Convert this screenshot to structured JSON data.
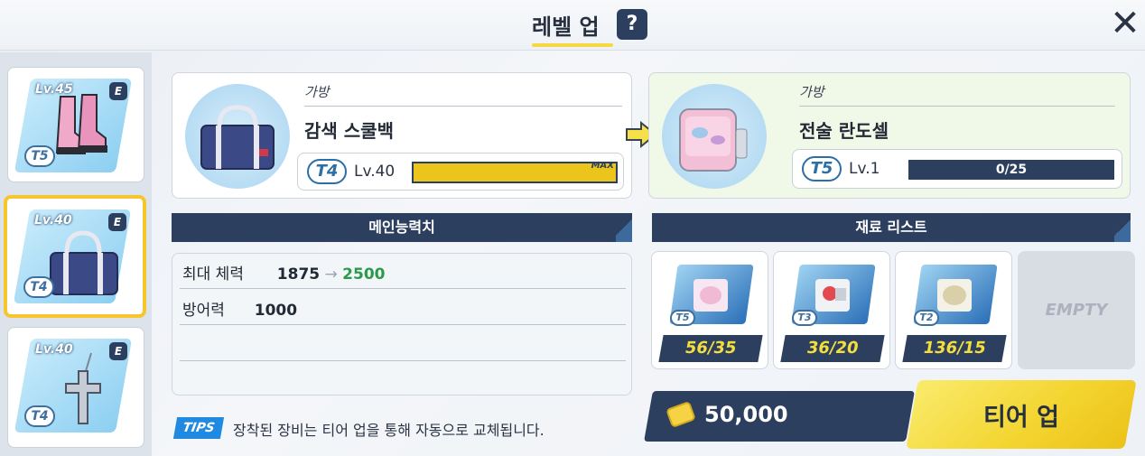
{
  "header": {
    "title": "레벨 업",
    "help_label": "?",
    "close_label": "✕"
  },
  "sidebar": {
    "items": [
      {
        "level": "Lv.45",
        "grade": "E",
        "tier": "T5",
        "icon": "boots-icon"
      },
      {
        "level": "Lv.40",
        "grade": "E",
        "tier": "T4",
        "icon": "bag-icon"
      },
      {
        "level": "Lv.40",
        "grade": "E",
        "tier": "T4",
        "icon": "cross-necklace-icon"
      }
    ]
  },
  "current_item": {
    "category": "가방",
    "name": "감색 스쿨백",
    "tier": "T4",
    "level": "Lv.40",
    "max_label": "MAX",
    "progress": 1.0
  },
  "next_item": {
    "category": "가방",
    "name": "전술 란도셀",
    "tier": "T5",
    "level": "Lv.1",
    "exp": "0/25",
    "progress": 0.0
  },
  "main_stats": {
    "header": "메인능력치",
    "rows": [
      {
        "label": "최대 체력",
        "value": "1875",
        "arrow": "→",
        "new_value": "2500"
      },
      {
        "label": "방어력",
        "value": "1000"
      }
    ]
  },
  "materials": {
    "header": "재료 리스트",
    "items": [
      {
        "tier": "T5",
        "count": "56/35"
      },
      {
        "tier": "T3",
        "count": "36/20"
      },
      {
        "tier": "T2",
        "count": "136/15"
      }
    ],
    "empty_label": "EMPTY"
  },
  "cost": {
    "amount": "50,000"
  },
  "tier_up_button": "티어 업",
  "tips": {
    "badge": "TIPS",
    "text": "장착된 장비는 티어 업을 통해 자동으로 교체됩니다."
  },
  "colors": {
    "navy": "#2d3f5e",
    "yellow": "#f3d42e",
    "green": "#2a9a4a",
    "tier_blue": "#2c6fa6"
  }
}
